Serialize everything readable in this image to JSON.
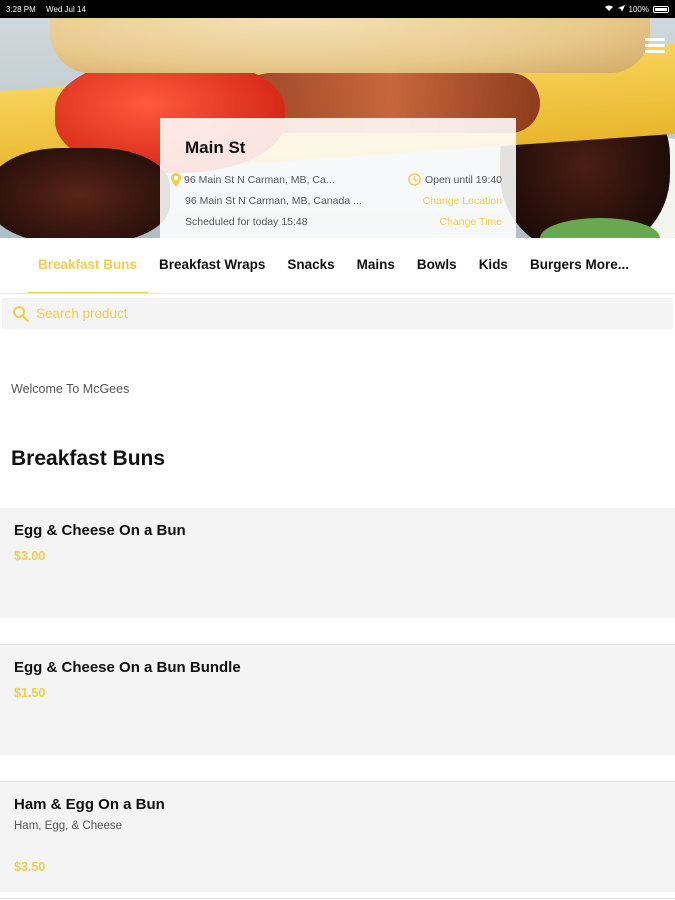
{
  "status_bar": {
    "time": "3:28 PM",
    "date": "Wed Jul 14",
    "battery": "100%"
  },
  "store": {
    "name": "Main St",
    "address_short": "96 Main St N Carman, MB, Ca...",
    "address_long": "96 Main St N Carman, MB, Canada ...",
    "hours": "Open until 19:40",
    "change_location": "Change Location",
    "scheduled": "Scheduled for today 15:48",
    "change_time": "Change Time"
  },
  "tabs": [
    {
      "label": "Breakfast Buns",
      "active": true
    },
    {
      "label": "Breakfast Wraps",
      "active": false
    },
    {
      "label": "Snacks",
      "active": false
    },
    {
      "label": "Mains",
      "active": false
    },
    {
      "label": "Bowls",
      "active": false
    },
    {
      "label": "Kids",
      "active": false
    },
    {
      "label": "Burgers More...",
      "active": false
    }
  ],
  "search": {
    "placeholder": "Search product",
    "value": ""
  },
  "welcome": "Welcome To McGees",
  "section_title": "Breakfast Buns",
  "products": [
    {
      "name": "Egg & Cheese On a Bun",
      "description": "",
      "price": "$3.00"
    },
    {
      "name": "Egg & Cheese On a Bun Bundle",
      "description": "",
      "price": "$1.50"
    },
    {
      "name": "Ham & Egg On a Bun",
      "description": "Ham, Egg, & Cheese",
      "price": "$3.50"
    }
  ],
  "colors": {
    "accent": "#f2cd4d",
    "text": "#111111",
    "card_bg": "#f4f4f4"
  }
}
